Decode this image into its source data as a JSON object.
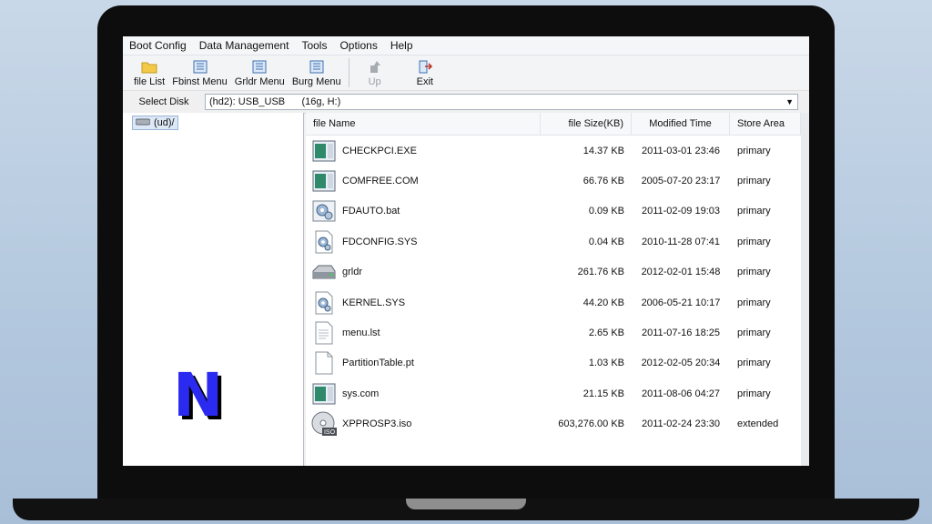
{
  "menu": [
    "Boot Config",
    "Data Management",
    "Tools",
    "Options",
    "Help"
  ],
  "toolbar": {
    "file_list": "file List",
    "fbinst_menu": "Fbinst Menu",
    "grldr_menu": "Grldr Menu",
    "burg_menu": "Burg Menu",
    "up": "Up",
    "exit": "Exit"
  },
  "disk": {
    "label": "Select Disk",
    "value": "(hd2): USB_USB      (16g, H:)"
  },
  "tree": {
    "root": "(ud)/"
  },
  "logo_letter": "N",
  "columns": {
    "name": "file Name",
    "size": "file Size(KB)",
    "time": "Modified Time",
    "area": "Store Area"
  },
  "files": [
    {
      "name": "CHECKPCI.EXE",
      "size": "14.37 KB",
      "time": "2011-03-01 23:46",
      "area": "primary",
      "icon": "exe-icon"
    },
    {
      "name": "COMFREE.COM",
      "size": "66.76 KB",
      "time": "2005-07-20 23:17",
      "area": "primary",
      "icon": "exe-icon"
    },
    {
      "name": "FDAUTO.bat",
      "size": "0.09 KB",
      "time": "2011-02-09 19:03",
      "area": "primary",
      "icon": "batch-gear-icon"
    },
    {
      "name": "FDCONFIG.SYS",
      "size": "0.04 KB",
      "time": "2010-11-28 07:41",
      "area": "primary",
      "icon": "system-gear-icon"
    },
    {
      "name": "grldr",
      "size": "261.76 KB",
      "time": "2012-02-01 15:48",
      "area": "primary",
      "icon": "drive-icon"
    },
    {
      "name": "KERNEL.SYS",
      "size": "44.20 KB",
      "time": "2006-05-21 10:17",
      "area": "primary",
      "icon": "system-gear-icon"
    },
    {
      "name": "menu.lst",
      "size": "2.65 KB",
      "time": "2011-07-16 18:25",
      "area": "primary",
      "icon": "text-file-icon"
    },
    {
      "name": "PartitionTable.pt",
      "size": "1.03 KB",
      "time": "2012-02-05 20:34",
      "area": "primary",
      "icon": "blank-file-icon"
    },
    {
      "name": "sys.com",
      "size": "21.15 KB",
      "time": "2011-08-06 04:27",
      "area": "primary",
      "icon": "exe-icon"
    },
    {
      "name": "XPPROSP3.iso",
      "size": "603,276.00 KB",
      "time": "2011-02-24 23:30",
      "area": "extended",
      "icon": "disc-iso-icon"
    }
  ],
  "iso_badge": "ISO"
}
